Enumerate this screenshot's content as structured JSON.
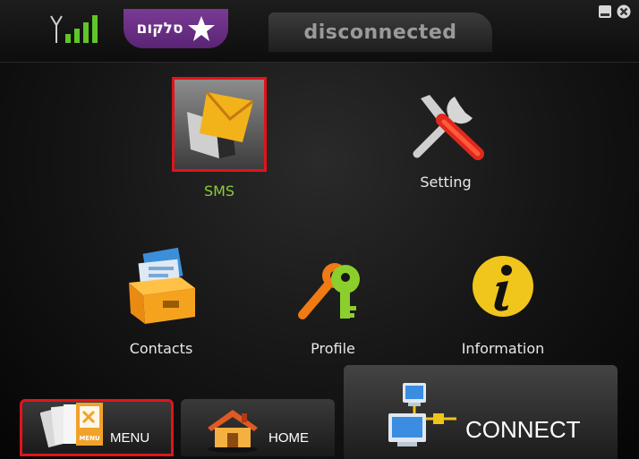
{
  "header": {
    "brand": "סלקום",
    "status": "disconnected"
  },
  "tiles": {
    "sms": "SMS",
    "setting": "Setting",
    "contacts": "Contacts",
    "profile": "Profile",
    "information": "Information"
  },
  "bottom": {
    "menu": "MENU",
    "menu_card_tag": "MENU",
    "home": "HOME",
    "connect": "CONNECT"
  },
  "colors": {
    "active_label": "#8ecb3a",
    "selection_border": "#e0141c",
    "brand_purple": "#6a2c86"
  }
}
